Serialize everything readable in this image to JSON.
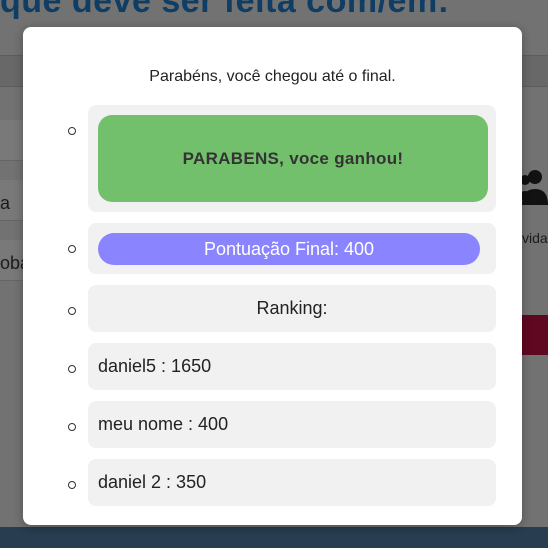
{
  "background": {
    "headline": "que deve ser feita com/em:",
    "left_texts": [
      "a",
      "oba"
    ],
    "right_text": "vida"
  },
  "modal": {
    "message": "Parabéns, você chegou até o final.",
    "win_text": "PARABENS, voce ganhou!",
    "score_text": "Pontuação Final: 400",
    "ranking_label": "Ranking:",
    "ranking": [
      "daniel5 : 1650",
      "meu nome : 400",
      "daniel 2 : 350"
    ]
  },
  "colors": {
    "win_card": "#72c06c",
    "score_pill": "#8a84ff",
    "item_bg": "#f1f1f1"
  }
}
